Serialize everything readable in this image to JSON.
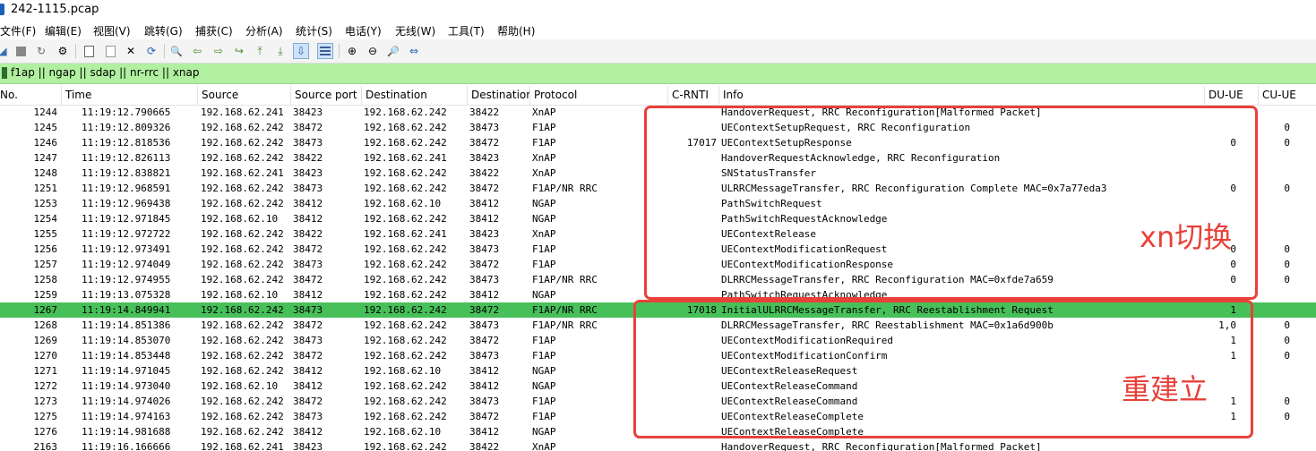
{
  "window": {
    "title": "242-1115.pcap"
  },
  "menu": [
    "文件(F)",
    "编辑(E)",
    "视图(V)",
    "跳转(G)",
    "捕获(C)",
    "分析(A)",
    "统计(S)",
    "电话(Y)",
    "无线(W)",
    "工具(T)",
    "帮助(H)"
  ],
  "toolbar": {
    "icons": [
      {
        "name": "shark-fin-start-icon",
        "glyph": "◢"
      },
      {
        "name": "stop-capture-icon",
        "glyph": ""
      },
      {
        "name": "restart-capture-icon",
        "glyph": "↻"
      },
      {
        "name": "capture-options-icon",
        "glyph": "⚙"
      },
      {
        "name": "open-file-icon",
        "glyph": ""
      },
      {
        "name": "save-file-icon",
        "glyph": ""
      },
      {
        "name": "close-file-icon",
        "glyph": "✕"
      },
      {
        "name": "reload-file-icon",
        "glyph": "⟳"
      },
      {
        "name": "find-packet-icon",
        "glyph": "🔍"
      },
      {
        "name": "go-back-icon",
        "glyph": "⇦"
      },
      {
        "name": "go-forward-icon",
        "glyph": "⇨"
      },
      {
        "name": "go-to-packet-icon",
        "glyph": "↪"
      },
      {
        "name": "go-first-packet-icon",
        "glyph": "⤒"
      },
      {
        "name": "go-last-packet-icon",
        "glyph": "⤓"
      },
      {
        "name": "auto-scroll-icon",
        "glyph": "⇩"
      },
      {
        "name": "colorize-icon",
        "glyph": ""
      },
      {
        "name": "zoom-in-icon",
        "glyph": "⊕"
      },
      {
        "name": "zoom-out-icon",
        "glyph": "⊖"
      },
      {
        "name": "zoom-normal-icon",
        "glyph": "🔎"
      },
      {
        "name": "resize-columns-icon",
        "glyph": "⇔"
      }
    ]
  },
  "filter": {
    "value": "f1ap || ngap || sdap || nr-rrc || xnap"
  },
  "columns": [
    "No.",
    "Time",
    "Source",
    "Source port",
    "Destination",
    "Destination",
    "Protocol",
    "C-RNTI",
    "Info",
    "DU-UE",
    "CU-UE"
  ],
  "packets": [
    {
      "no": "1244",
      "time": "11:19:12.790665",
      "src": "192.168.62.241",
      "sport": "38423",
      "dst": "192.168.62.242",
      "dport": "38422",
      "proto": "XnAP",
      "crnti": "",
      "info": "HandoverRequest, RRC Reconfiguration[Malformed Packet]",
      "du": "",
      "cu": ""
    },
    {
      "no": "1245",
      "time": "11:19:12.809326",
      "src": "192.168.62.242",
      "sport": "38472",
      "dst": "192.168.62.242",
      "dport": "38473",
      "proto": "F1AP",
      "crnti": "",
      "info": "UEContextSetupRequest, RRC Reconfiguration",
      "du": "",
      "cu": "0"
    },
    {
      "no": "1246",
      "time": "11:19:12.818536",
      "src": "192.168.62.242",
      "sport": "38473",
      "dst": "192.168.62.242",
      "dport": "38472",
      "proto": "F1AP",
      "crnti": "17017",
      "info": "UEContextSetupResponse",
      "du": "0",
      "cu": "0"
    },
    {
      "no": "1247",
      "time": "11:19:12.826113",
      "src": "192.168.62.242",
      "sport": "38422",
      "dst": "192.168.62.241",
      "dport": "38423",
      "proto": "XnAP",
      "crnti": "",
      "info": "HandoverRequestAcknowledge, RRC Reconfiguration",
      "du": "",
      "cu": ""
    },
    {
      "no": "1248",
      "time": "11:19:12.838821",
      "src": "192.168.62.241",
      "sport": "38423",
      "dst": "192.168.62.242",
      "dport": "38422",
      "proto": "XnAP",
      "crnti": "",
      "info": "SNStatusTransfer",
      "du": "",
      "cu": ""
    },
    {
      "no": "1251",
      "time": "11:19:12.968591",
      "src": "192.168.62.242",
      "sport": "38473",
      "dst": "192.168.62.242",
      "dport": "38472",
      "proto": "F1AP/NR RRC",
      "crnti": "",
      "info": "ULRRCMessageTransfer, RRC Reconfiguration Complete MAC=0x7a77eda3",
      "du": "0",
      "cu": "0"
    },
    {
      "no": "1253",
      "time": "11:19:12.969438",
      "src": "192.168.62.242",
      "sport": "38412",
      "dst": "192.168.62.10",
      "dport": "38412",
      "proto": "NGAP",
      "crnti": "",
      "info": "PathSwitchRequest",
      "du": "",
      "cu": ""
    },
    {
      "no": "1254",
      "time": "11:19:12.971845",
      "src": "192.168.62.10",
      "sport": "38412",
      "dst": "192.168.62.242",
      "dport": "38412",
      "proto": "NGAP",
      "crnti": "",
      "info": "PathSwitchRequestAcknowledge",
      "du": "",
      "cu": ""
    },
    {
      "no": "1255",
      "time": "11:19:12.972722",
      "src": "192.168.62.242",
      "sport": "38422",
      "dst": "192.168.62.241",
      "dport": "38423",
      "proto": "XnAP",
      "crnti": "",
      "info": "UEContextRelease",
      "du": "",
      "cu": ""
    },
    {
      "no": "1256",
      "time": "11:19:12.973491",
      "src": "192.168.62.242",
      "sport": "38472",
      "dst": "192.168.62.242",
      "dport": "38473",
      "proto": "F1AP",
      "crnti": "",
      "info": "UEContextModificationRequest",
      "du": "0",
      "cu": "0"
    },
    {
      "no": "1257",
      "time": "11:19:12.974049",
      "src": "192.168.62.242",
      "sport": "38473",
      "dst": "192.168.62.242",
      "dport": "38472",
      "proto": "F1AP",
      "crnti": "",
      "info": "UEContextModificationResponse",
      "du": "0",
      "cu": "0"
    },
    {
      "no": "1258",
      "time": "11:19:12.974955",
      "src": "192.168.62.242",
      "sport": "38472",
      "dst": "192.168.62.242",
      "dport": "38473",
      "proto": "F1AP/NR RRC",
      "crnti": "",
      "info": "DLRRCMessageTransfer, RRC Reconfiguration MAC=0xfde7a659",
      "du": "0",
      "cu": "0"
    },
    {
      "no": "1259",
      "time": "11:19:13.075328",
      "src": "192.168.62.10",
      "sport": "38412",
      "dst": "192.168.62.242",
      "dport": "38412",
      "proto": "NGAP",
      "crnti": "",
      "info": "PathSwitchRequestAcknowledge",
      "du": "",
      "cu": ""
    },
    {
      "no": "1267",
      "time": "11:19:14.849941",
      "src": "192.168.62.242",
      "sport": "38473",
      "dst": "192.168.62.242",
      "dport": "38472",
      "proto": "F1AP/NR RRC",
      "crnti": "17018",
      "info": "InitialULRRCMessageTransfer, RRC Reestablishment Request",
      "du": "1",
      "cu": ""
    },
    {
      "no": "1268",
      "time": "11:19:14.851386",
      "src": "192.168.62.242",
      "sport": "38472",
      "dst": "192.168.62.242",
      "dport": "38473",
      "proto": "F1AP/NR RRC",
      "crnti": "",
      "info": "DLRRCMessageTransfer, RRC Reestablishment MAC=0x1a6d900b",
      "du": "1,0",
      "cu": "0"
    },
    {
      "no": "1269",
      "time": "11:19:14.853070",
      "src": "192.168.62.242",
      "sport": "38473",
      "dst": "192.168.62.242",
      "dport": "38472",
      "proto": "F1AP",
      "crnti": "",
      "info": "UEContextModificationRequired",
      "du": "1",
      "cu": "0"
    },
    {
      "no": "1270",
      "time": "11:19:14.853448",
      "src": "192.168.62.242",
      "sport": "38472",
      "dst": "192.168.62.242",
      "dport": "38473",
      "proto": "F1AP",
      "crnti": "",
      "info": "UEContextModificationConfirm",
      "du": "1",
      "cu": "0"
    },
    {
      "no": "1271",
      "time": "11:19:14.971045",
      "src": "192.168.62.242",
      "sport": "38412",
      "dst": "192.168.62.10",
      "dport": "38412",
      "proto": "NGAP",
      "crnti": "",
      "info": "UEContextReleaseRequest",
      "du": "",
      "cu": ""
    },
    {
      "no": "1272",
      "time": "11:19:14.973040",
      "src": "192.168.62.10",
      "sport": "38412",
      "dst": "192.168.62.242",
      "dport": "38412",
      "proto": "NGAP",
      "crnti": "",
      "info": "UEContextReleaseCommand",
      "du": "",
      "cu": ""
    },
    {
      "no": "1273",
      "time": "11:19:14.974026",
      "src": "192.168.62.242",
      "sport": "38472",
      "dst": "192.168.62.242",
      "dport": "38473",
      "proto": "F1AP",
      "crnti": "",
      "info": "UEContextReleaseCommand",
      "du": "1",
      "cu": "0"
    },
    {
      "no": "1275",
      "time": "11:19:14.974163",
      "src": "192.168.62.242",
      "sport": "38473",
      "dst": "192.168.62.242",
      "dport": "38472",
      "proto": "F1AP",
      "crnti": "",
      "info": "UEContextReleaseComplete",
      "du": "1",
      "cu": "0"
    },
    {
      "no": "1276",
      "time": "11:19:14.981688",
      "src": "192.168.62.242",
      "sport": "38412",
      "dst": "192.168.62.10",
      "dport": "38412",
      "proto": "NGAP",
      "crnti": "",
      "info": "UEContextReleaseComplete",
      "du": "",
      "cu": ""
    },
    {
      "no": "2163",
      "time": "11:19:16.166666",
      "src": "192.168.62.241",
      "sport": "38423",
      "dst": "192.168.62.242",
      "dport": "38422",
      "proto": "XnAP",
      "crnti": "",
      "info": "HandoverRequest, RRC Reconfiguration[Malformed Packet]",
      "du": "",
      "cu": ""
    }
  ],
  "selected_row": 13,
  "annotations": [
    {
      "label": "xn切换",
      "color": "#e8413a"
    },
    {
      "label": "重建立",
      "color": "#e8413a"
    }
  ]
}
